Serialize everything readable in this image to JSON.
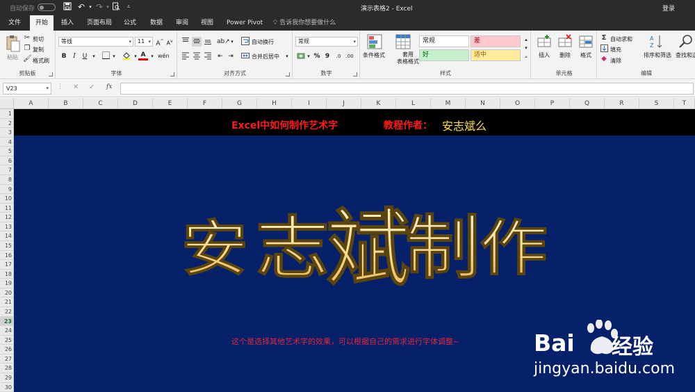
{
  "titlebar": {
    "autosave_label": "自动保存",
    "doc_title": "演示表格2  -  Excel",
    "login_label": "登录"
  },
  "tabs": [
    {
      "label": "文件"
    },
    {
      "label": "开始"
    },
    {
      "label": "插入"
    },
    {
      "label": "页面布局"
    },
    {
      "label": "公式"
    },
    {
      "label": "数据"
    },
    {
      "label": "审阅"
    },
    {
      "label": "视图"
    },
    {
      "label": "Power Pivot"
    }
  ],
  "tell_me": "告诉我你想要做什么",
  "ribbon": {
    "clipboard": {
      "paste": "粘贴",
      "cut": "剪切",
      "copy": "复制",
      "format_painter": "格式刷",
      "label": "剪贴板"
    },
    "font": {
      "name": "等线",
      "size": "11",
      "bold": "B",
      "italic": "I",
      "underline": "U",
      "label": "字体"
    },
    "alignment": {
      "wrap": "自动换行",
      "merge": "合并后居中",
      "label": "对齐方式"
    },
    "number": {
      "format": "常规",
      "percent": "%",
      "comma": "9",
      "label": "数字"
    },
    "styles": {
      "conditional": "条件格式",
      "as_table": "套用\n表格格式",
      "normal": "常规",
      "bad": "差",
      "good": "好",
      "neutral": "适中",
      "label": "样式"
    },
    "cells": {
      "insert": "插入",
      "delete": "删除",
      "format": "格式",
      "label": "单元格"
    },
    "editing": {
      "autosum": "自动求和",
      "fill": "填充",
      "clear": "清除",
      "sort": "排序和筛选",
      "find": "查找和选择",
      "label": "编辑"
    },
    "colors": {
      "bad_bg": "#ffc7ce",
      "bad_fg": "#9c0006",
      "good_bg": "#c6efce",
      "good_fg": "#006100",
      "neutral_bg": "#ffeb9c",
      "neutral_fg": "#9c5700"
    }
  },
  "formula_bar": {
    "name_box": "V23",
    "fx": "fx",
    "value": ""
  },
  "columns": [
    "A",
    "B",
    "C",
    "D",
    "E",
    "F",
    "G",
    "H",
    "I",
    "J",
    "K",
    "L",
    "M",
    "N",
    "O",
    "P",
    "Q",
    "R",
    "S",
    "T"
  ],
  "rows": [
    "1",
    "2",
    "3",
    "4",
    "5",
    "6",
    "7",
    "8",
    "9",
    "10",
    "11",
    "12",
    "13",
    "14",
    "15",
    "16",
    "17",
    "18",
    "19",
    "20",
    "21",
    "22",
    "23",
    "24",
    "25",
    "26",
    "27",
    "28",
    "29",
    "30"
  ],
  "selected_row": "23",
  "sheet": {
    "title": "Excel中如何制作艺术字",
    "author_label": "教程作者：",
    "author_name": "安志斌么",
    "wordart_text": "安志斌制作",
    "note": "这个是选择其他艺术字的效果，可以根据自己的需求进行字体调整~",
    "band_color": "#000000",
    "background_color": "#06216a",
    "title_color": "#ff1a1a",
    "author_color": "#ffe24a"
  },
  "watermark": {
    "brand_left": "Bai",
    "brand_right": "经验",
    "url": "jingyan.baidu.com"
  }
}
